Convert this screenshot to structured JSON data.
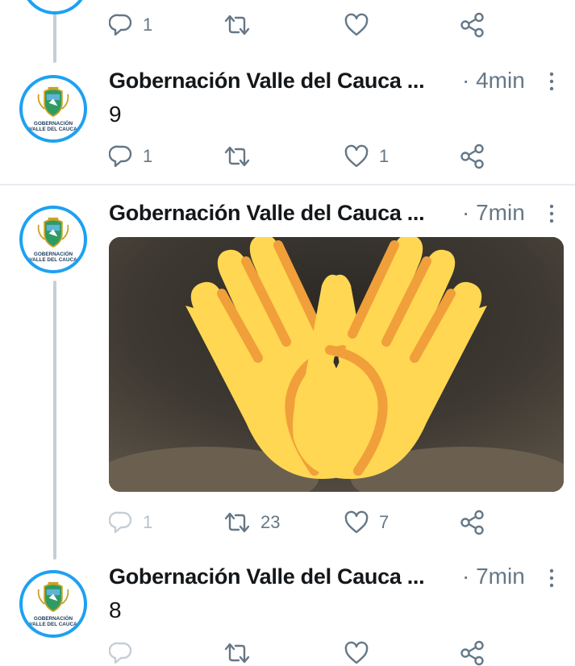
{
  "tweets": [
    {
      "reply_count": "1"
    },
    {
      "author": "Gobernación Valle del Cauca ...",
      "time": "· 4min",
      "text": "9",
      "reply_count": "1",
      "like_count": "1"
    },
    {
      "author": "Gobernación Valle del Cauca ...",
      "time": "· 7min",
      "media_icon": "raising-hands-emoji",
      "reply_count": "1",
      "retweet_count": "23",
      "like_count": "7"
    },
    {
      "author": "Gobernación Valle del Cauca ...",
      "time": "· 7min",
      "text": "8"
    }
  ],
  "avatar_logo_text": [
    "GOBERNACIÓN",
    "VALLE DEL CAUCA"
  ],
  "colors": {
    "accent": "#1da1f2",
    "icon_gray": "#657786",
    "divider": "#e6ecf0",
    "thread_line": "#c8ced3",
    "emoji_yellow": "#ffd752",
    "emoji_orange": "#f19f3a"
  }
}
